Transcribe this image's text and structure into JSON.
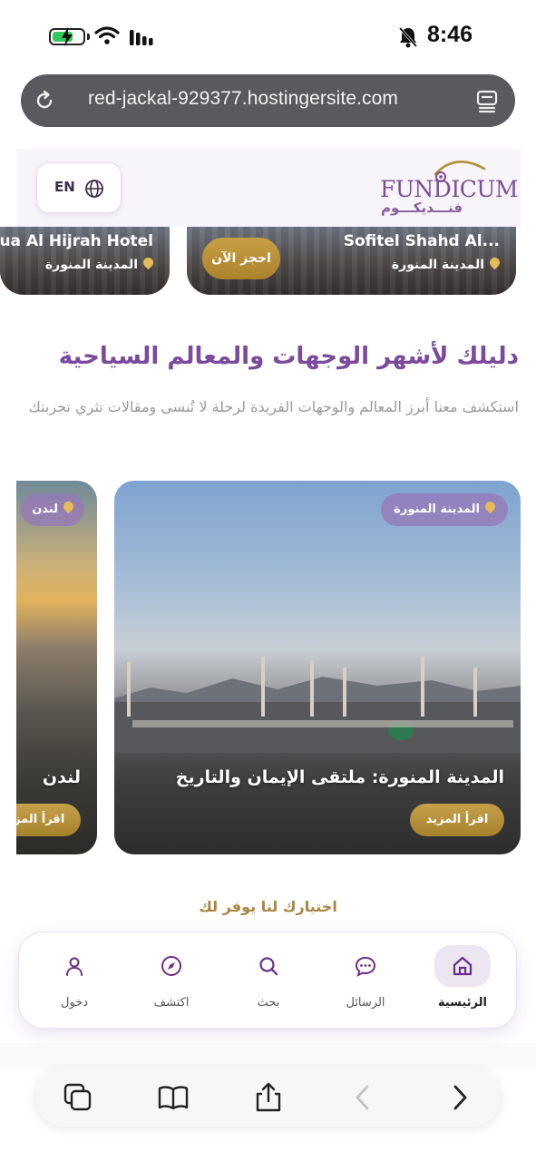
{
  "status_bar": {
    "time": "8:46"
  },
  "browser": {
    "url": "red-jackal-929377.hostingersite.com"
  },
  "header": {
    "lang_label": "EN",
    "brand_en": "FUNDICUM",
    "brand_ar": "فنـــديكـــوم"
  },
  "hotels": [
    {
      "name": "Sofitel Shahd Al...",
      "location": "المدينة المنورة",
      "book_label": "احجز الآن"
    },
    {
      "name": "ua Al Hijrah Hotel",
      "location": "المدينة المنورة"
    }
  ],
  "guide": {
    "title": "دليلك لأشهر الوجهات والمعالم السياحية",
    "description": "استكشف معنا أبرز المعالم والوجهات الفريدة لرحلة لا تُنسى ومقالات تثري تجربتك"
  },
  "articles": [
    {
      "location": "المدينة المنورة",
      "title": "المدينة المنورة: ملتقى الإيمان والتاريخ",
      "read_more": "اقرأ المزيد"
    },
    {
      "location": "لندن",
      "title": "لندن",
      "read_more": "اقرأ المزيد"
    }
  ],
  "why": {
    "title": "اختيارك لنا يوفر لك"
  },
  "nav": {
    "items": [
      {
        "label": "الرئيسية",
        "icon": "home-icon",
        "active": true
      },
      {
        "label": "الرسائل",
        "icon": "chat-icon",
        "active": false
      },
      {
        "label": "بحث",
        "icon": "search-icon",
        "active": false
      },
      {
        "label": "اكتشف",
        "icon": "compass-icon",
        "active": false
      },
      {
        "label": "دخول",
        "icon": "user-icon",
        "active": false
      }
    ]
  },
  "colors": {
    "brand_purple": "#7a4a9c",
    "gold": "#b48e35",
    "nav_active_bg": "#ece6f1"
  }
}
